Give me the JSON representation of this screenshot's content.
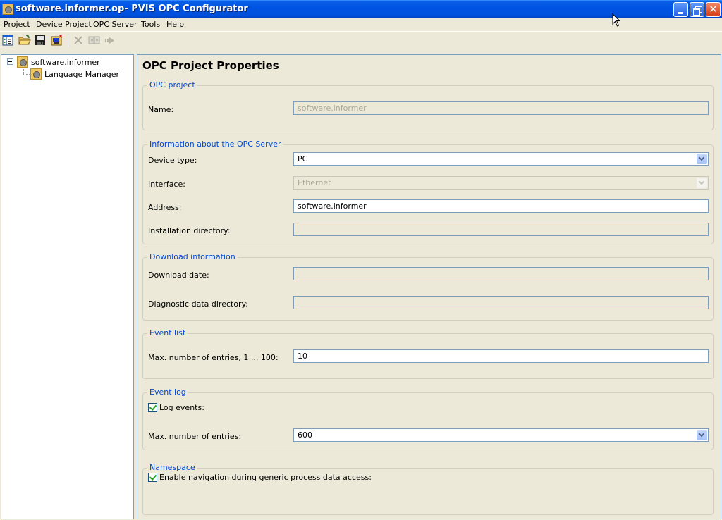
{
  "window": {
    "title": "software.informer.op- PVIS OPC Configurator",
    "controls": {
      "minimize": "minimize",
      "maximize": "restore",
      "close": "✕"
    }
  },
  "menu": [
    "Project",
    "Device Project",
    "OPC Server",
    "Tools",
    "Help"
  ],
  "toolbar": [
    {
      "icon": "properties-view-icon",
      "enabled": true
    },
    {
      "icon": "open-folder-icon",
      "enabled": true
    },
    {
      "icon": "save-disk-icon",
      "enabled": true
    },
    {
      "icon": "download-device-icon",
      "enabled": true
    },
    {
      "icon": "delete-x-icon",
      "enabled": false
    },
    {
      "icon": "compare-icon",
      "enabled": false
    },
    {
      "icon": "forward-arrow-icon",
      "enabled": false
    }
  ],
  "tree": {
    "root": {
      "label": "software.informer",
      "expanded": true
    },
    "children": [
      {
        "label": "Language Manager"
      }
    ]
  },
  "page": {
    "title": "OPC Project Properties",
    "groups": {
      "opc_project": {
        "title": "OPC project",
        "name_label": "Name:",
        "name_value": "software.informer"
      },
      "server_info": {
        "title": "Information about the OPC Server",
        "device_type_label": "Device type:",
        "device_type_value": "PC",
        "interface_label": "Interface:",
        "interface_value": "Ethernet",
        "address_label": "Address:",
        "address_value": "software.informer",
        "install_dir_label": "Installation directory:",
        "install_dir_value": ""
      },
      "download_info": {
        "title": "Download information",
        "download_date_label": "Download date:",
        "download_date_value": "",
        "diag_dir_label": "Diagnostic data directory:",
        "diag_dir_value": ""
      },
      "event_list": {
        "title": "Event list",
        "max_entries_label": "Max. number of entries, 1 ... 100:",
        "max_entries_value": "10"
      },
      "event_log": {
        "title": "Event log",
        "log_events_label": "Log events:",
        "log_events_checked": true,
        "max_entries_label": "Max. number of entries:",
        "max_entries_value": "600"
      },
      "namespace": {
        "title": "Namespace",
        "enable_nav_label": "Enable navigation during generic process data access:",
        "enable_nav_checked": true
      }
    }
  }
}
